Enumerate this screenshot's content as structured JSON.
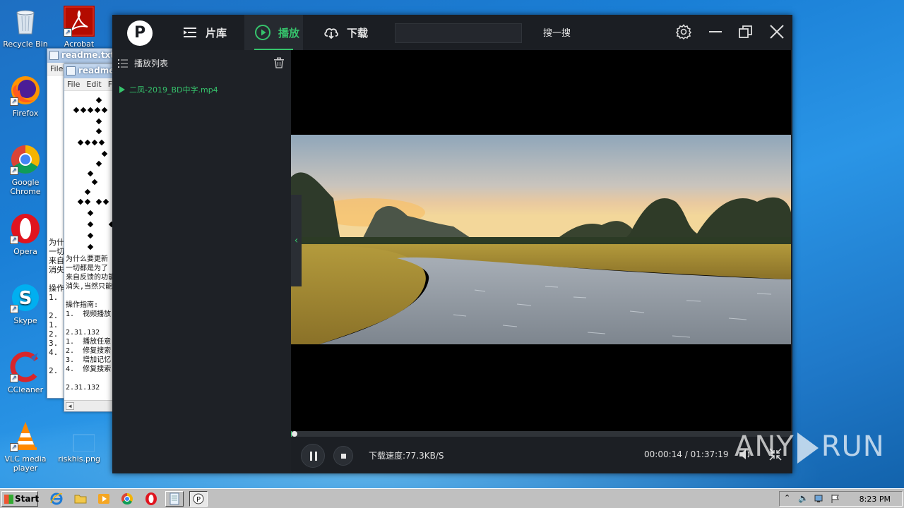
{
  "desktop": {
    "icons": [
      {
        "label": "Recycle Bin"
      },
      {
        "label": "Acrobat"
      },
      {
        "label": "Firefox"
      },
      {
        "label": "Google Chrome"
      },
      {
        "label": "Opera"
      },
      {
        "label": "Skype"
      },
      {
        "label": "CCleaner"
      },
      {
        "label": "VLC media player"
      },
      {
        "label": "riskhis.png"
      }
    ]
  },
  "notepad_back": {
    "title": "readme.txt -",
    "menu": [
      "File"
    ]
  },
  "notepad_front": {
    "title": "readme.",
    "menu": [
      "File",
      "Edit",
      "F"
    ],
    "text_lines": [
      "为什么要更新",
      "一切都是为了",
      "来自反馈的功能",
      "消失,当然只能",
      "",
      "操作指南:",
      "1.  视频播放",
      "",
      "2.31.132",
      "1.  播放任意",
      "2.  修复搜索",
      "3.  增加记忆",
      "4.  修复搜索",
      "",
      "2.31.132"
    ],
    "back_text_lines": [
      "为什",
      "一切",
      "来自",
      "消失",
      "",
      "操作",
      "1.",
      "",
      "2.",
      "1.",
      "2.",
      "3.",
      "4.",
      "",
      "2."
    ]
  },
  "player": {
    "logo": "P",
    "nav": [
      {
        "label": "片库",
        "icon": "library-icon"
      },
      {
        "label": "播放",
        "icon": "play-circle-icon"
      },
      {
        "label": "下载",
        "icon": "cloud-download-icon"
      }
    ],
    "search_placeholder": "",
    "search_button": "搜一搜",
    "playlist": {
      "title": "播放列表",
      "items": [
        "二凤-2019_BD中字.mp4"
      ]
    },
    "download_speed": "下载速度:77.3KB/S",
    "time_current": "00:00:14",
    "time_total": "/ 01:37:19",
    "progress": 0.002
  },
  "watermark": {
    "left": "ANY",
    "right": "RUN"
  },
  "taskbar": {
    "start_label": "Start",
    "clock": "8:23 PM"
  },
  "colors": {
    "accent": "#36c46c",
    "player_bg": "#1c1f24",
    "desktop_blue": "#1a7fd6"
  }
}
